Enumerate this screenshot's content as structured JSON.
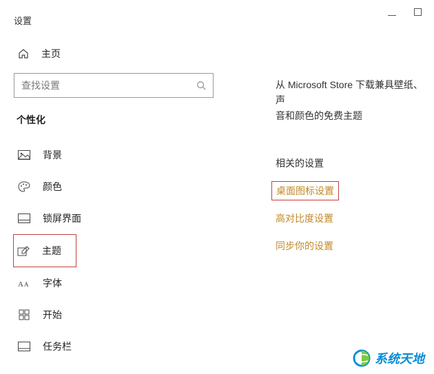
{
  "window": {
    "title": "设置"
  },
  "sidebar": {
    "home": "主页",
    "search_placeholder": "查找设置",
    "category": "个性化",
    "items": [
      {
        "label": "背景"
      },
      {
        "label": "颜色"
      },
      {
        "label": "锁屏界面"
      },
      {
        "label": "主题"
      },
      {
        "label": "字体"
      },
      {
        "label": "开始"
      },
      {
        "label": "任务栏"
      }
    ]
  },
  "main": {
    "promo_line1": "从 Microsoft Store 下载兼具壁纸、声",
    "promo_line2": "音和颜色的免费主题",
    "related_heading": "相关的设置",
    "links": [
      "桌面图标设置",
      "高对比度设置",
      "同步你的设置"
    ]
  },
  "watermark": "系统天地"
}
